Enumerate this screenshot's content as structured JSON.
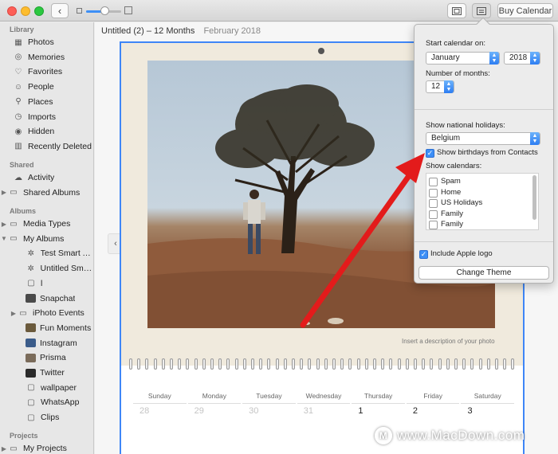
{
  "toolbar": {
    "back_icon": "chevron-left-icon",
    "buy_label": "Buy Calendar"
  },
  "sidebar": {
    "library_head": "Library",
    "library": [
      {
        "label": "Photos",
        "icon": "photos-icon"
      },
      {
        "label": "Memories",
        "icon": "memories-icon"
      },
      {
        "label": "Favorites",
        "icon": "heart-icon"
      },
      {
        "label": "People",
        "icon": "person-icon"
      },
      {
        "label": "Places",
        "icon": "pin-icon"
      },
      {
        "label": "Imports",
        "icon": "clock-icon"
      },
      {
        "label": "Hidden",
        "icon": "eye-slash-icon"
      },
      {
        "label": "Recently Deleted",
        "icon": "trash-icon"
      }
    ],
    "shared_head": "Shared",
    "shared": [
      {
        "label": "Activity",
        "icon": "cloud-icon"
      },
      {
        "label": "Shared Albums",
        "icon": "folder-icon"
      }
    ],
    "albums_head": "Albums",
    "albums": [
      {
        "label": "Media Types",
        "icon": "folder-icon"
      },
      {
        "label": "My Albums",
        "icon": "folder-icon"
      },
      {
        "label": "Test Smart A...",
        "icon": "gear-icon"
      },
      {
        "label": "Untitled Sma...",
        "icon": "gear-icon"
      },
      {
        "label": "l",
        "icon": "album-icon"
      },
      {
        "label": "Snapchat",
        "icon": "thumb-icon"
      },
      {
        "label": "iPhoto Events",
        "icon": "folder-icon"
      },
      {
        "label": "Fun Moments",
        "icon": "thumb-icon"
      },
      {
        "label": "Instagram",
        "icon": "thumb-icon"
      },
      {
        "label": "Prisma",
        "icon": "thumb-icon"
      },
      {
        "label": "Twitter",
        "icon": "thumb-icon"
      },
      {
        "label": "wallpaper",
        "icon": "album-icon"
      },
      {
        "label": "WhatsApp",
        "icon": "album-icon"
      },
      {
        "label": "Clips",
        "icon": "album-icon"
      }
    ],
    "projects_head": "Projects",
    "projects": [
      {
        "label": "My Projects",
        "icon": "folder-icon"
      }
    ]
  },
  "main": {
    "project_title": "Untitled (2) – 12 Months",
    "current_month": "February 2018",
    "photo_description": "Insert a description of your photo",
    "weekdays": [
      "Sunday",
      "Monday",
      "Tuesday",
      "Wednesday",
      "Thursday",
      "Friday",
      "Saturday"
    ],
    "first_row": [
      {
        "n": "28",
        "muted": true
      },
      {
        "n": "29",
        "muted": true
      },
      {
        "n": "30",
        "muted": true
      },
      {
        "n": "31",
        "muted": true
      },
      {
        "n": "1",
        "muted": false
      },
      {
        "n": "2",
        "muted": false
      },
      {
        "n": "3",
        "muted": false
      }
    ]
  },
  "popover": {
    "start_label": "Start calendar on:",
    "start_month": "January",
    "start_year": "2018",
    "months_label": "Number of months:",
    "months_value": "12",
    "holidays_label": "Show national holidays:",
    "holidays_country": "Belgium",
    "birthdays_label": "Show birthdays from Contacts",
    "birthdays_checked": true,
    "calendars_label": "Show calendars:",
    "calendars": [
      {
        "label": "Spam",
        "checked": false
      },
      {
        "label": "Home",
        "checked": false
      },
      {
        "label": "US Holidays",
        "checked": false
      },
      {
        "label": "Family",
        "checked": false
      },
      {
        "label": "Family",
        "checked": false
      }
    ],
    "apple_logo_label": "Include Apple logo",
    "apple_logo_checked": true,
    "theme_button": "Change Theme"
  },
  "watermark": {
    "text": "www.MacDown.com",
    "logo": "M"
  },
  "colors": {
    "accent": "#3e86f7",
    "annotation_arrow": "#e31b1b"
  }
}
